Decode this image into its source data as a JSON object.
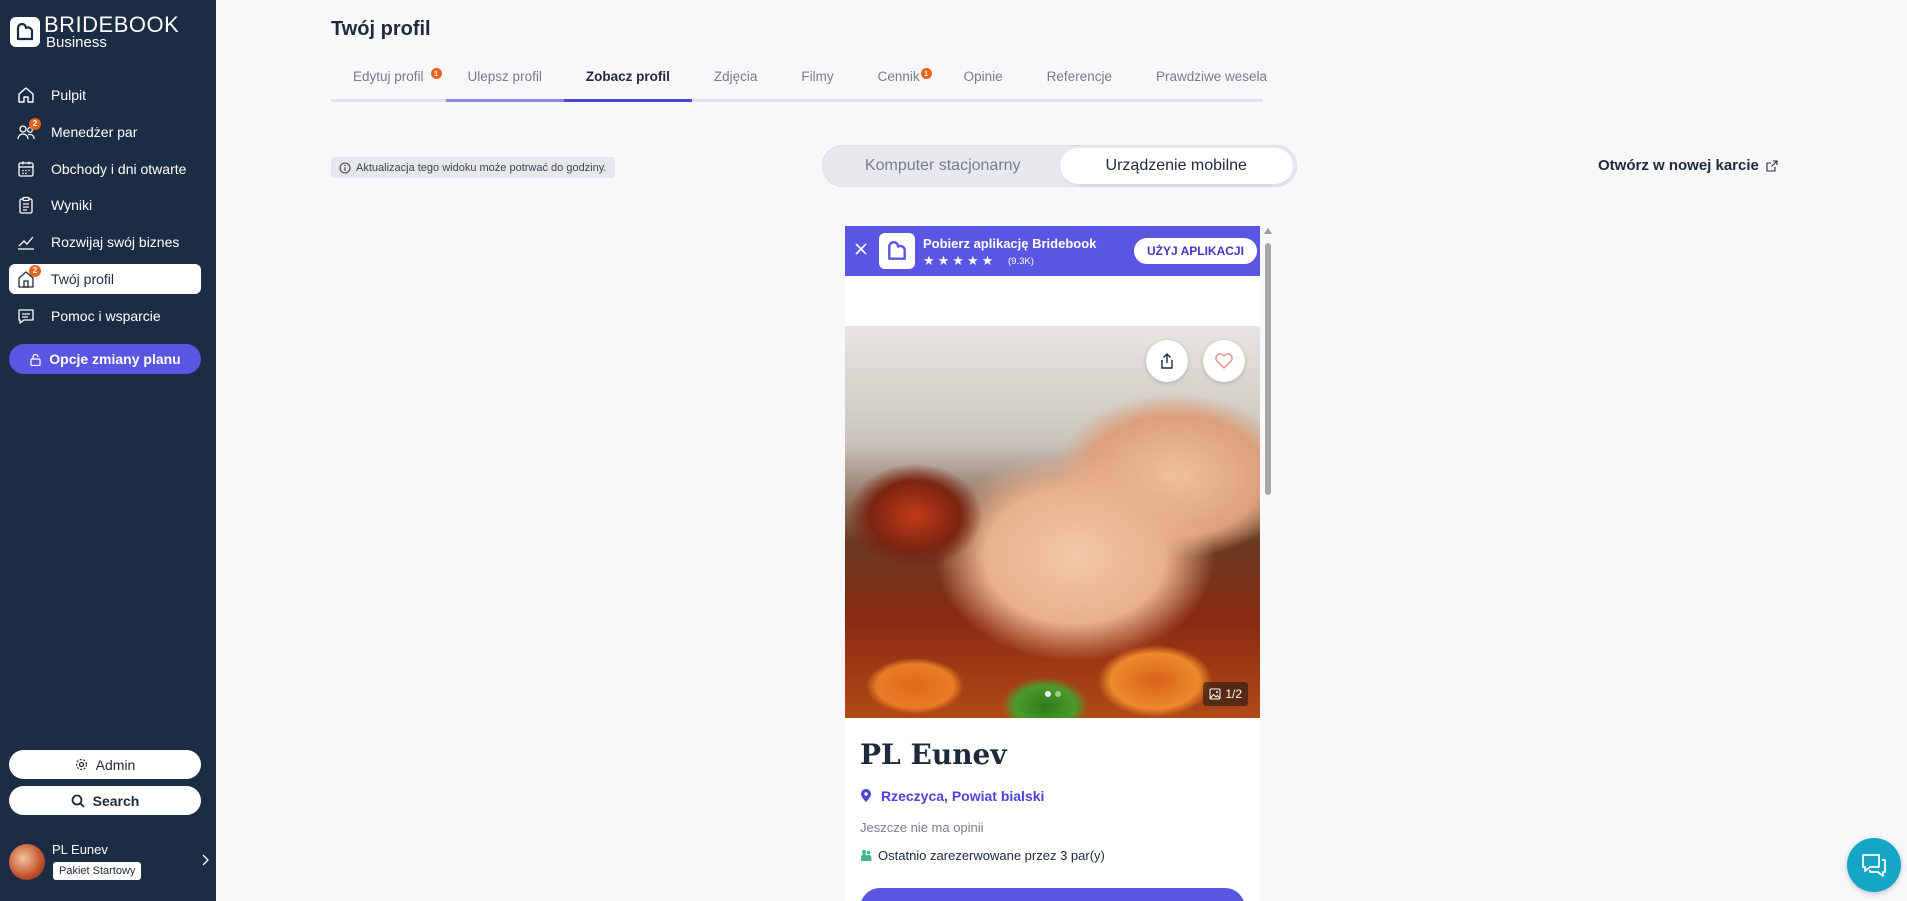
{
  "brand": {
    "title": "BRIDEBOOK",
    "subtitle": "Business"
  },
  "sidebar": {
    "items": [
      {
        "label": "Pulpit",
        "icon": "home-icon",
        "badge": ""
      },
      {
        "label": "Menedżer par",
        "icon": "users-icon",
        "badge": "2"
      },
      {
        "label": "Obchody i dni otwarte",
        "icon": "calendar-icon",
        "badge": ""
      },
      {
        "label": "Wyniki",
        "icon": "clipboard-icon",
        "badge": ""
      },
      {
        "label": "Rozwijaj swój biznes",
        "icon": "chart-line-icon",
        "badge": ""
      },
      {
        "label": "Twój profil",
        "icon": "storefront-icon",
        "badge": "2"
      },
      {
        "label": "Pomoc i wsparcie",
        "icon": "chat-icon",
        "badge": ""
      }
    ],
    "plan_button": "Opcje zmiany planu",
    "admin_button": "Admin",
    "search_button": "Search",
    "user": {
      "name": "PL Eunev",
      "plan": "Pakiet Startowy"
    }
  },
  "page": {
    "title": "Twój profil"
  },
  "tabs": [
    {
      "label": "Edytuj profil",
      "badge": "1"
    },
    {
      "label": "Ulepsz profil",
      "badge": ""
    },
    {
      "label": "Zobacz profil",
      "badge": ""
    },
    {
      "label": "Zdjęcia",
      "badge": ""
    },
    {
      "label": "Filmy",
      "badge": ""
    },
    {
      "label": "Cennik",
      "badge": "1"
    },
    {
      "label": "Opinie",
      "badge": ""
    },
    {
      "label": "Referencje",
      "badge": ""
    },
    {
      "label": "Prawdziwe wesela",
      "badge": ""
    }
  ],
  "info_note": "Aktualizacja tego widoku może potrwać do godziny.",
  "view_toggle": {
    "desktop": "Komputer stacjonarny",
    "mobile": "Urządzenie mobilne",
    "selected": "mobile"
  },
  "open_new_tab": "Otwórz w nowej karcie",
  "preview": {
    "banner": {
      "title": "Pobierz aplikację Bridebook",
      "stars": "★★★★★",
      "rating_count": "(9.3K)",
      "button": "UŻYJ APLIKACJI"
    },
    "gallery": {
      "counter": "1/2",
      "dots_total": 2,
      "dot_active": 1
    },
    "vendor_name": "PL Eunev",
    "location": "Rzeczyca, Powiat bialski",
    "reviews": "Jeszcze nie ma opinii",
    "booked": "Ostatnio zarezerwowane przez 3 par(y)"
  },
  "colors": {
    "sidebar_bg": "#1c2c44",
    "accent": "#5b55e3",
    "badge": "#e8641c",
    "chat_fab": "#14a6c6"
  }
}
